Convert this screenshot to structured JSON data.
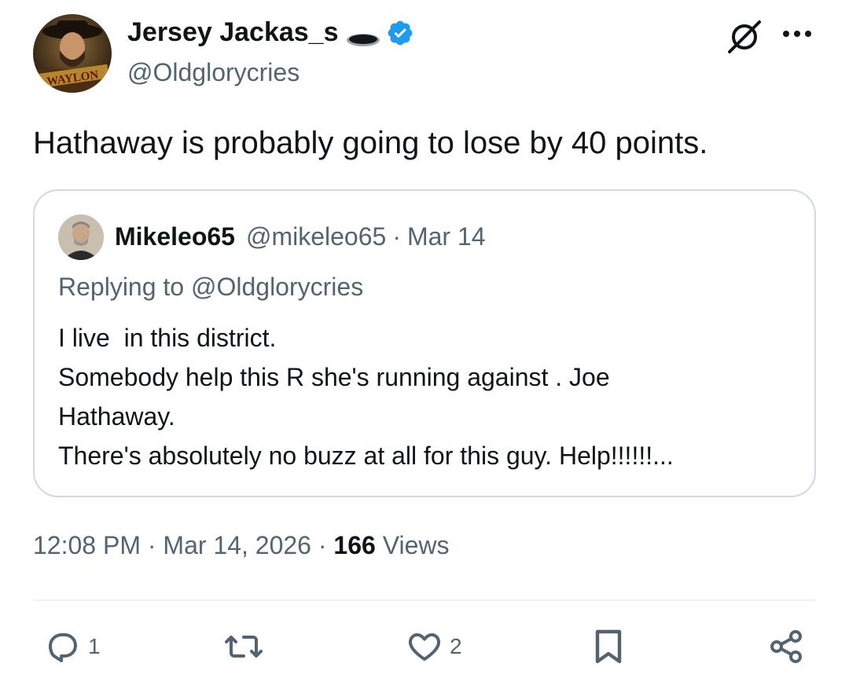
{
  "author": {
    "display_name": "Jersey Jackas_s",
    "handle": "@Oldglorycries",
    "avatar_text": "WAYLON"
  },
  "tweet": {
    "text": "Hathaway is probably going to lose by 40 points."
  },
  "quoted_tweet": {
    "display_name": "Mikeleo65",
    "handle": "@mikeleo65",
    "separator": "·",
    "date": "Mar 14",
    "replying_to": "Replying to @Oldglorycries",
    "lines": [
      "I live  in this district.",
      "Somebody help this R she's running against . Joe",
      "Hathaway.",
      "There's absolutely no buzz at all for this guy. Help!!!!!!..."
    ]
  },
  "meta": {
    "time": "12:08 PM",
    "separator": "·",
    "date": "Mar 14, 2026",
    "views_count": "166",
    "views_label": "Views"
  },
  "actions": {
    "reply_count": "1",
    "like_count": "2"
  },
  "icons": [
    "grok-icon",
    "more-icon",
    "verified-icon",
    "reply-icon",
    "retweet-icon",
    "like-icon",
    "bookmark-icon",
    "share-icon"
  ],
  "colors": {
    "text": "#0f1419",
    "secondary": "#536471",
    "verified": "#1d9bf0",
    "border": "#cfd9de"
  }
}
